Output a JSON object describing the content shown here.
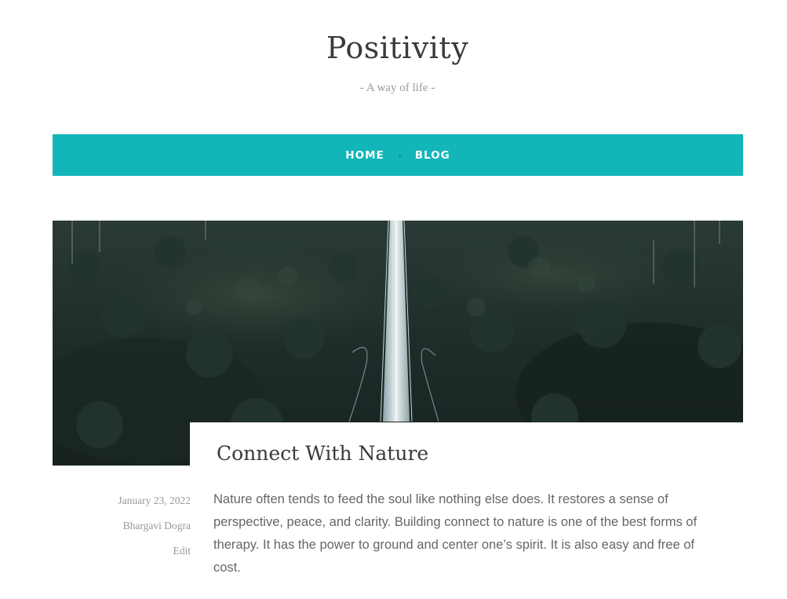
{
  "site": {
    "title": "Positivity",
    "tagline": "- A way of life -"
  },
  "nav": {
    "items": [
      {
        "label": "HOME"
      },
      {
        "label": "BLOG"
      }
    ]
  },
  "colors": {
    "nav_background": "#13b6b8",
    "nav_text": "#ffffff",
    "title_text": "#3a3a3a",
    "meta_text": "#9a9a9a",
    "body_text": "#666666"
  },
  "post": {
    "title": "Connect With Nature",
    "date": "January 23, 2022",
    "author": "Bhargavi Dogra",
    "edit_label": "Edit",
    "excerpt": "Nature often tends to feed the soul like nothing else does. It restores a sense of perspective, peace, and clarity. Building connect to nature is one of the best forms of therapy. It has the power to ground and center one’s spirit. It is also easy and free of cost."
  }
}
